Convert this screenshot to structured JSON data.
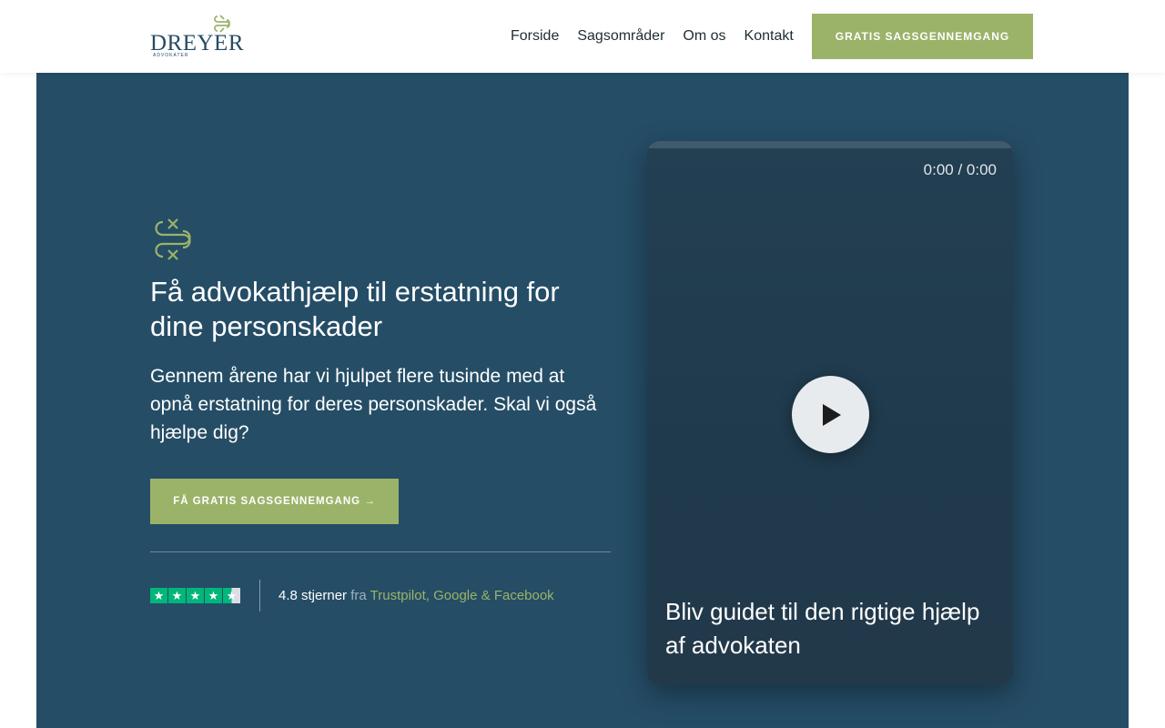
{
  "brand": {
    "name": "DREYER",
    "sub": "ADVOKATER",
    "accent": "#9bb369",
    "dark": "#254d66"
  },
  "nav": {
    "items": [
      "Forside",
      "Sagsområder",
      "Om os",
      "Kontakt"
    ],
    "cta": "GRATIS SAGSGENNEMGANG"
  },
  "hero": {
    "title": "Få advokathjælp til erstatning for dine personskader",
    "text": "Gennem årene har vi hjulpet flere tusinde med at opnå erstatning for deres personskader. Skal vi også hjælpe dig?",
    "button": "FÅ GRATIS SAGSGENNEMGANG →",
    "rating": {
      "stars": 4.5,
      "value_text": "4.8 stjerner",
      "from": "fra",
      "sources": "Trustpilot, Google & Facebook"
    }
  },
  "video": {
    "time": "0:00 / 0:00",
    "caption": "Bliv guidet til den rigtige hjælp af advokaten"
  }
}
